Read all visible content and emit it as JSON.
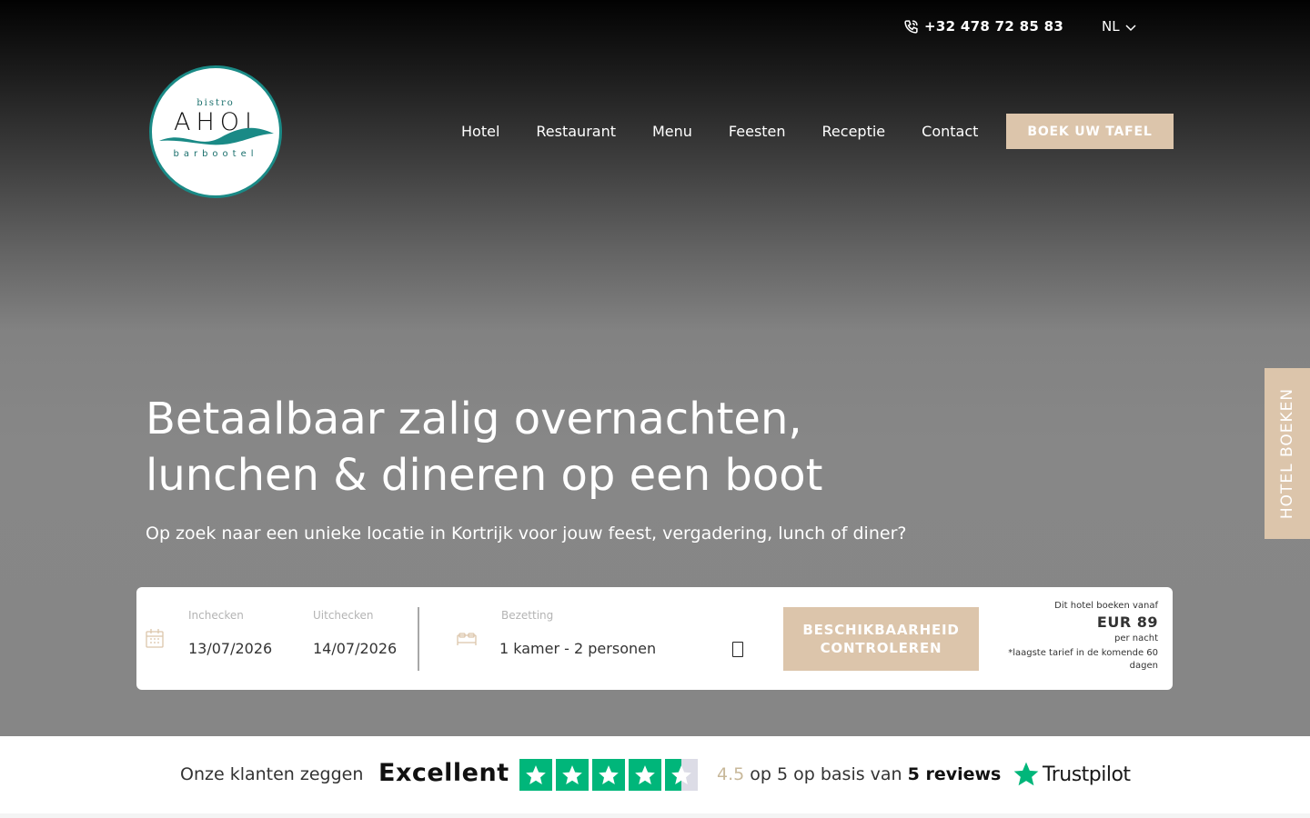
{
  "topbar": {
    "phone": "+32 478 72 85 83",
    "phone_icon": "phone-icon",
    "language": "NL"
  },
  "logo": {
    "top_text": "bistro",
    "main_text": "AHOI",
    "bottom_text": "barbootel"
  },
  "nav": {
    "items": [
      "Hotel",
      "Restaurant",
      "Menu",
      "Feesten",
      "Receptie",
      "Contact"
    ],
    "cta": "BOEK UW TAFEL"
  },
  "side_tab": "HOTEL BOEKEN",
  "hero": {
    "headline_line1": "Betaalbaar zalig overnachten,",
    "headline_line2": "lunchen & dineren op een boot",
    "subline": "Op zoek naar een unieke locatie in Kortrijk voor jouw feest, vergadering, lunch of diner?"
  },
  "booking": {
    "checkin_label": "Inchecken",
    "checkin_value": "13/07/2026",
    "checkout_label": "Uitchecken",
    "checkout_value": "14/07/2026",
    "occupancy_label": "Bezetting",
    "occupancy_value": "1 kamer - 2 personen",
    "check_button": "BESCHIKBAARHEID CONTROLEREN",
    "price_intro": "Dit hotel boeken vanaf",
    "price": "EUR 89",
    "price_unit": "per nacht",
    "price_note": "*laagste tarief in de komende 60 dagen"
  },
  "trustpilot": {
    "intro": "Onze klanten zeggen",
    "rating_word": "Excellent",
    "score": "4.5",
    "score_text": " op 5 op basis van ",
    "reviews": "5 reviews",
    "brand": "Trustpilot",
    "stars": 4.5
  },
  "colors": {
    "accent": "#dcc5ab",
    "logo_teal": "#1a8a86",
    "trust_green": "#00b67a"
  }
}
